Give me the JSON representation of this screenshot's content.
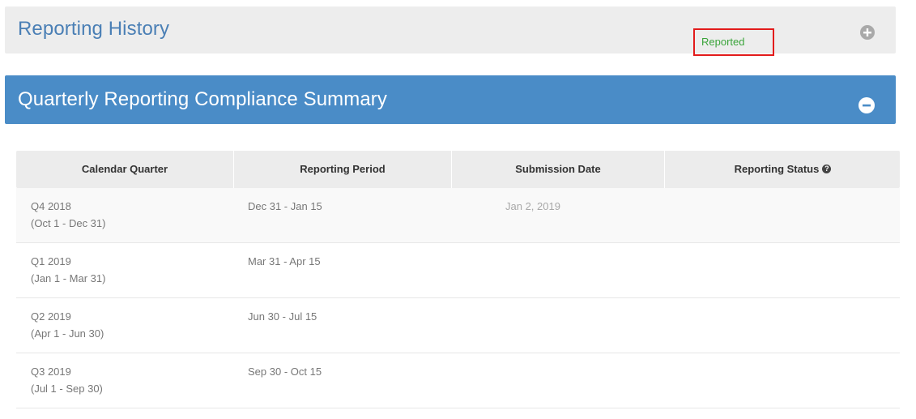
{
  "panels": {
    "history": {
      "title": "Reporting History",
      "icon": "plus-circle-icon"
    },
    "quarterly": {
      "title": "Quarterly Reporting Compliance Summary",
      "icon": "minus-circle-icon"
    }
  },
  "table": {
    "headers": [
      "Calendar Quarter",
      "Reporting Period",
      "Submission Date",
      "Reporting Status"
    ],
    "rows": [
      {
        "quarter": "Q4 2018",
        "range": "(Oct 1 - Dec 31)",
        "period": "Dec 31 - Jan 15",
        "submission_date": "Jan 2, 2019",
        "status": "Reported"
      },
      {
        "quarter": "Q1 2019",
        "range": "(Jan 1 - Mar 31)",
        "period": "Mar 31 - Apr 15",
        "submission_date": "",
        "status": ""
      },
      {
        "quarter": "Q2 2019",
        "range": "(Apr 1 - Jun 30)",
        "period": "Jun 30 - Jul 15",
        "submission_date": "",
        "status": ""
      },
      {
        "quarter": "Q3 2019",
        "range": "(Jul 1 - Sep 30)",
        "period": "Sep 30 - Oct 15",
        "submission_date": "",
        "status": ""
      }
    ]
  },
  "colors": {
    "accent": "#4a8cc7",
    "status_reported": "#3aa43a",
    "highlight_box": "#e21b1b"
  }
}
